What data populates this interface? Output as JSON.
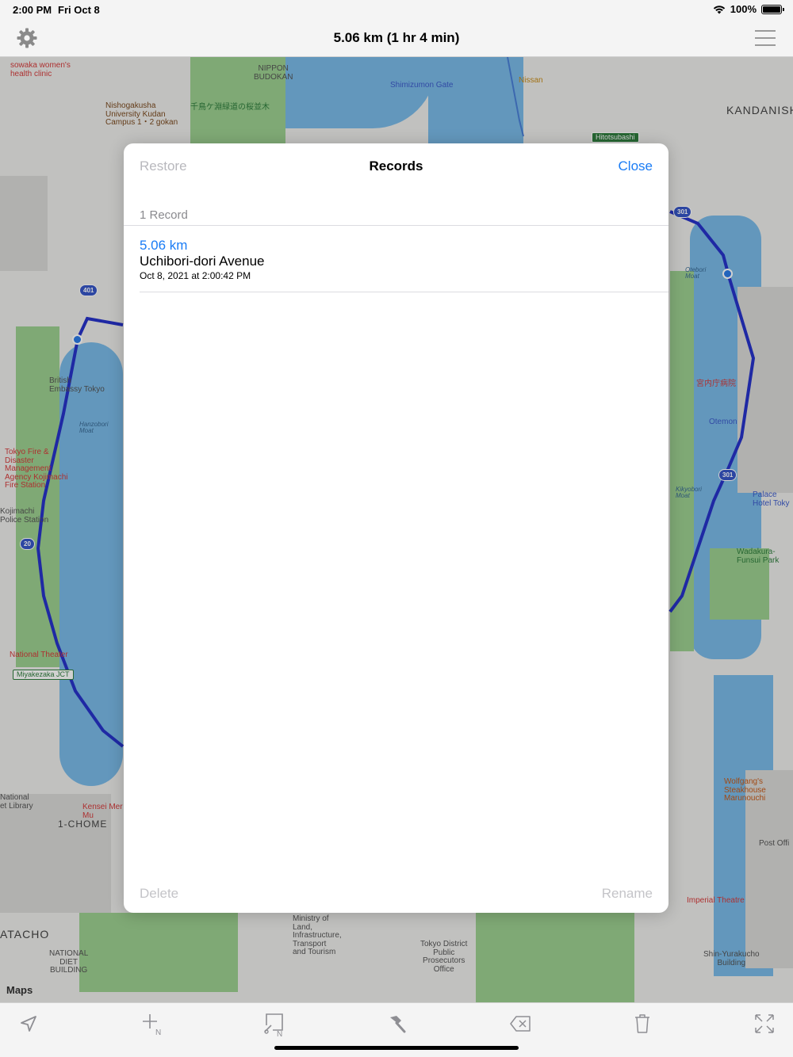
{
  "status_bar": {
    "time": "2:00 PM",
    "date": "Fri Oct 8",
    "battery": "100%"
  },
  "nav": {
    "title": "5.06 km (1 hr 4 min)",
    "settings_icon": "gear-icon",
    "menu_icon": "hamburger-menu-icon"
  },
  "map": {
    "attribution": "Maps",
    "labels": {
      "nippon_budokan": "NIPPON\nBUDOKAN",
      "shimizumon": "Shimizumon Gate",
      "nissan": "Nissan",
      "kandanishiki": "KANDANISHI",
      "hitotsubashi": "Hitotsubashi",
      "nishogakusha": "Nishogakusha\nUniversity Kudan\nCampus 1・2 gokan",
      "sowaka": "sowaka women's\nhealth clinic",
      "chidorigafuchi": "千鳥ケ淵緑道の桜並木",
      "british_embassy": "British\nEmbassy Tokyo",
      "hanzobori": "Hanzobori\nMoat",
      "tokyo_fire": "Tokyo Fire &\nDisaster\nManagement\nAgency Kojimachi\nFire Station",
      "kojimachi_police": "Kojimachi\nPolice Station",
      "national_theater": "National Theater",
      "miyakezaka": "Miyakezaka JCT",
      "national_library": "National\net Library",
      "chome": "1-CHOME",
      "atacho": "ATACHO",
      "national_diet": "NATIONAL\nDIET\nBUILDING",
      "ministry": "Ministry of\nLand,\nInfrastructure,\nTransport\nand Tourism",
      "tokyo_district": "Tokyo District\nPublic\nProsecutors\nOffice",
      "kunaicho": "宮内庁病院",
      "otemon": "Otemon",
      "palace_hotel": "Palace\nHotel Toky",
      "wadakura": "Wadakura-\nFunsui Park",
      "wolfgangs": "Wolfgang's\nSteakhouse\nMarunouchi",
      "post_office": "Post Offi",
      "imperial_theatre": "Imperial Theatre",
      "shin_yurakucho": "Shin-Yurakucho\nBuilding",
      "kenzei": "Kensei Mer\nMu",
      "otebori": "Otebori\nMoat",
      "kikyobori": "Kikyobori\nMoat"
    }
  },
  "modal": {
    "title": "Records",
    "restore_label": "Restore",
    "close_label": "Close",
    "section_header": "1 Record",
    "records": [
      {
        "distance": "5.06 km",
        "name": "Uchibori-dori Avenue",
        "date": "Oct 8, 2021 at 2:00:42 PM"
      }
    ],
    "delete_label": "Delete",
    "rename_label": "Rename"
  },
  "toolbar": {
    "items": [
      {
        "icon": "location-arrow-icon"
      },
      {
        "icon": "add-point-icon"
      },
      {
        "icon": "edit-point-icon"
      },
      {
        "icon": "hammer-icon"
      },
      {
        "icon": "backspace-icon"
      },
      {
        "icon": "trash-icon"
      },
      {
        "icon": "fullscreen-icon"
      }
    ]
  }
}
